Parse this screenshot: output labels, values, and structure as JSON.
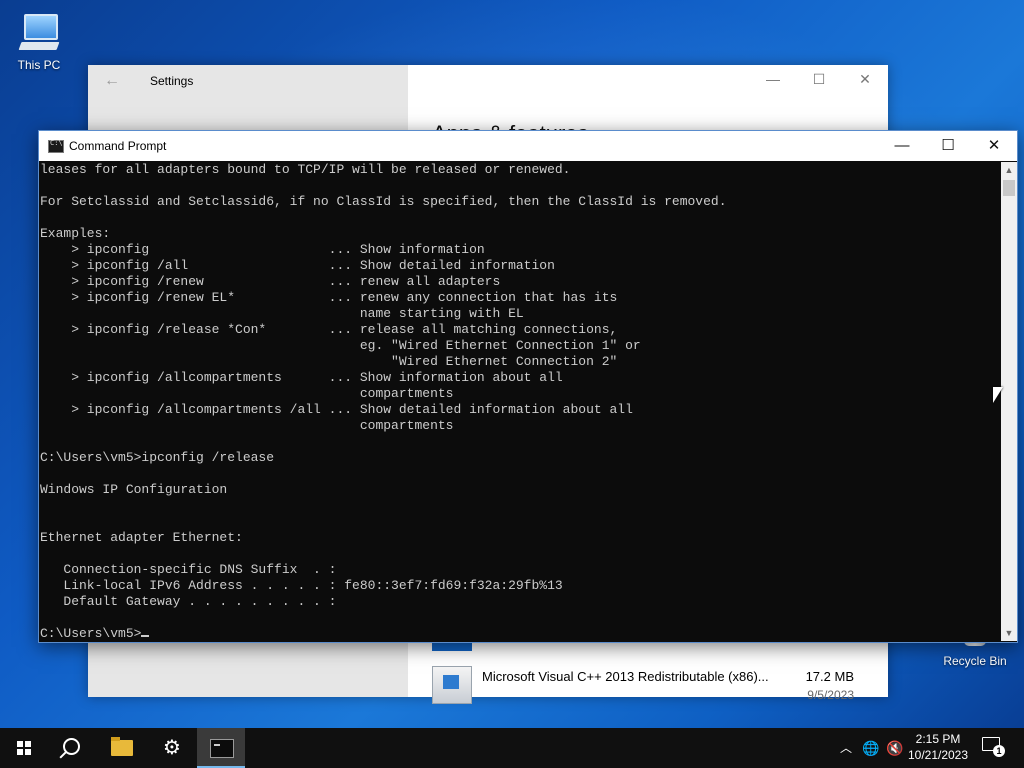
{
  "desktop": {
    "icons": [
      {
        "label": "This PC",
        "icon": "this-pc-icon"
      },
      {
        "label": "Recycle Bin",
        "icon": "recycle-bin-icon"
      }
    ]
  },
  "settings": {
    "title": "Settings",
    "back_icon": "←",
    "min_icon": "—",
    "max_icon": "☐",
    "close_icon": "✕",
    "heading": "Apps & features",
    "apps": [
      {
        "name": "Microsoft Visual C++ 2013 Redistributable (x86)...",
        "size": "17.2 MB",
        "date": "9/5/2023"
      }
    ]
  },
  "cmd": {
    "title": "Command Prompt",
    "min_icon": "—",
    "max_icon": "☐",
    "close_icon": "✕",
    "output": "leases for all adapters bound to TCP/IP will be released or renewed.\n\nFor Setclassid and Setclassid6, if no ClassId is specified, then the ClassId is removed.\n\nExamples:\n    > ipconfig                       ... Show information\n    > ipconfig /all                  ... Show detailed information\n    > ipconfig /renew                ... renew all adapters\n    > ipconfig /renew EL*            ... renew any connection that has its\n                                         name starting with EL\n    > ipconfig /release *Con*        ... release all matching connections,\n                                         eg. \"Wired Ethernet Connection 1\" or\n                                             \"Wired Ethernet Connection 2\"\n    > ipconfig /allcompartments      ... Show information about all\n                                         compartments\n    > ipconfig /allcompartments /all ... Show detailed information about all\n                                         compartments\n\nC:\\Users\\vm5>ipconfig /release\n\nWindows IP Configuration\n\n\nEthernet adapter Ethernet:\n\n   Connection-specific DNS Suffix  . :\n   Link-local IPv6 Address . . . . . : fe80::3ef7:fd69:f32a:29fb%13\n   Default Gateway . . . . . . . . . :\n\n",
    "prompt": "C:\\Users\\vm5>"
  },
  "taskbar": {
    "items": [
      {
        "name": "start-button",
        "icon": "windows-logo-icon"
      },
      {
        "name": "search-button",
        "icon": "search-icon"
      },
      {
        "name": "file-explorer",
        "icon": "folder-icon"
      },
      {
        "name": "settings",
        "icon": "gear-icon"
      },
      {
        "name": "command-prompt",
        "icon": "cmd-icon"
      }
    ],
    "gear_glyph": "⚙",
    "tray": {
      "chevron": "︿",
      "network": "🌐",
      "volume": "🔇"
    },
    "time": "2:15 PM",
    "date": "10/21/2023",
    "notification_count": "1"
  }
}
